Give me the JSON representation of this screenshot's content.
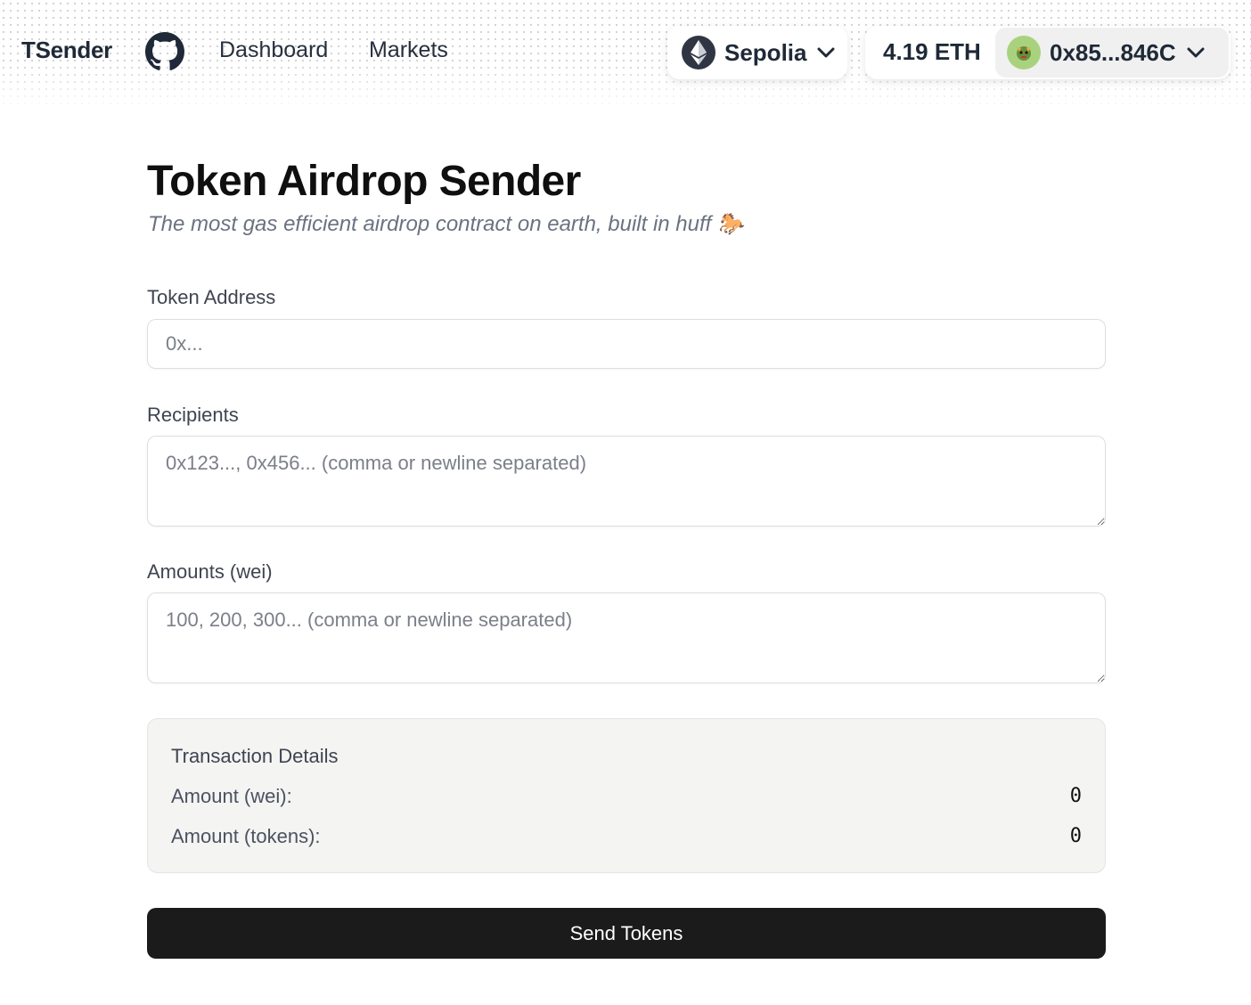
{
  "header": {
    "brand": "TSender",
    "nav": {
      "dashboard": "Dashboard",
      "markets": "Markets"
    },
    "chain": {
      "name": "Sepolia",
      "icon": "ethereum-icon"
    },
    "account": {
      "balance": "4.19 ETH",
      "address": "0x85...846C",
      "avatar_icon": "avatar-emoji-icon"
    },
    "github_icon": "github-icon"
  },
  "main": {
    "title": "Token Airdrop Sender",
    "subtitle": "The most gas efficient airdrop contract on earth, built in huff 🐎",
    "token_address": {
      "label": "Token Address",
      "placeholder": "0x...",
      "value": ""
    },
    "recipients": {
      "label": "Recipients",
      "placeholder": "0x123..., 0x456... (comma or newline separated)",
      "value": ""
    },
    "amounts": {
      "label": "Amounts (wei)",
      "placeholder": "100, 200, 300... (comma or newline separated)",
      "value": ""
    },
    "details": {
      "title": "Transaction Details",
      "amount_wei_label": "Amount (wei):",
      "amount_wei_value": "0",
      "amount_tokens_label": "Amount (tokens):",
      "amount_tokens_value": "0"
    },
    "send_button": "Send Tokens"
  },
  "colors": {
    "button_bg": "#1b1b1b",
    "details_bg": "#f4f4f3",
    "avatar_bg": "#a9d27e"
  }
}
